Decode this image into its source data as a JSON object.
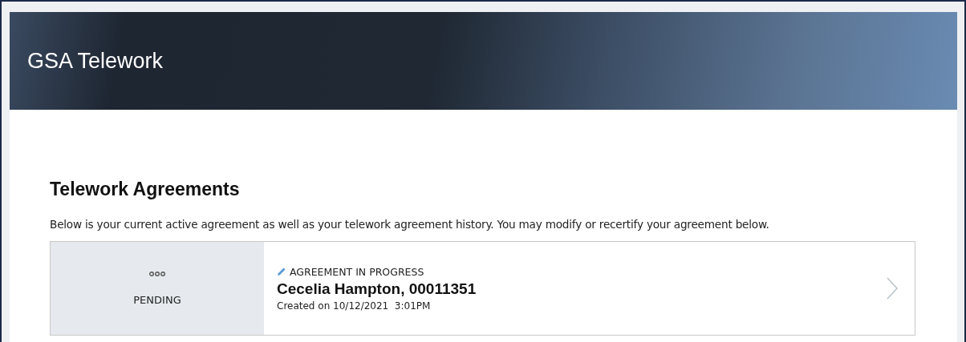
{
  "header": {
    "title": "GSA Telework"
  },
  "page": {
    "heading": "Telework Agreements",
    "intro": "Below is your current active agreement as well as your telework agreement history. You may modify or recertify your agreement below."
  },
  "agreements": [
    {
      "status": "PENDING",
      "kind": "pending",
      "label": "AGREEMENT IN PROGRESS",
      "name": "Cecelia Hampton, 00011351",
      "created": "Created on 10/12/2021  3:01PM"
    }
  ]
}
